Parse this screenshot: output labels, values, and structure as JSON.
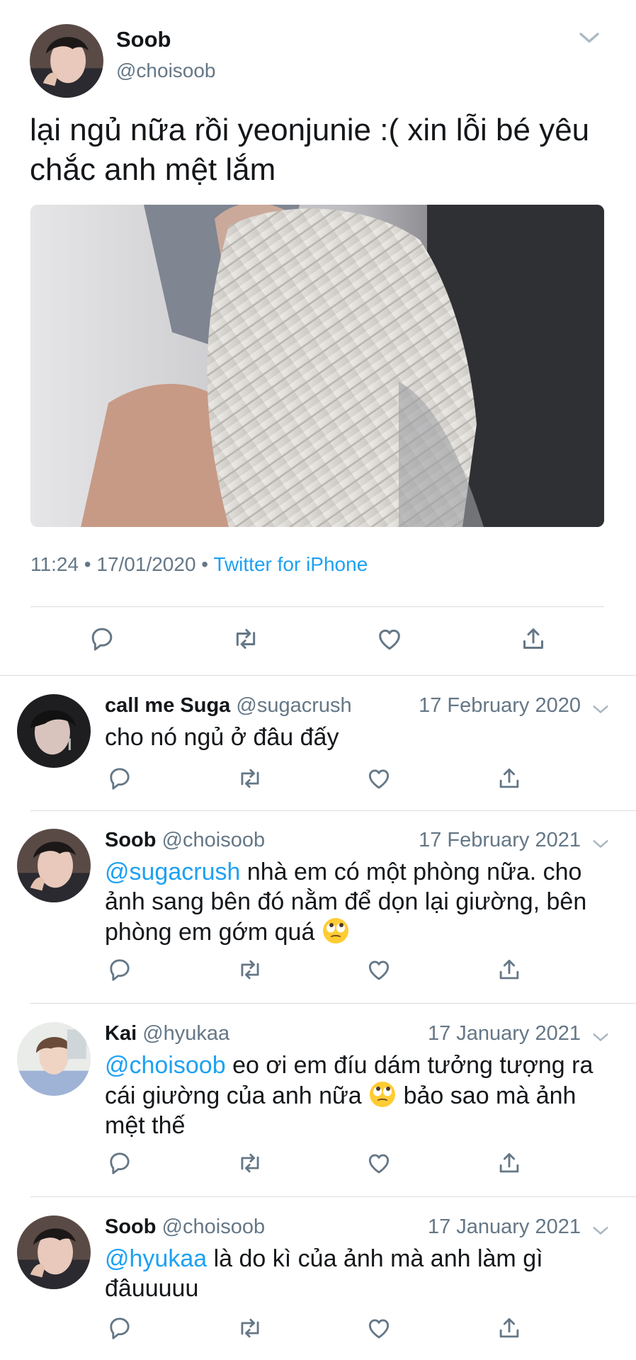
{
  "main_tweet": {
    "author_name": "Soob",
    "author_handle": "@choisoob",
    "text": "lại ngủ nữa rồi yeonjunie :( xin lỗi bé yêu chắc anh mệt lắm",
    "time": "11:24",
    "date": "17/01/2020",
    "source": "Twitter for iPhone",
    "separator": "•"
  },
  "icons": {
    "reply": "speech-bubble-icon",
    "retweet": "retweet-icon",
    "like": "heart-icon",
    "share": "share-icon",
    "more": "chevron-down-icon",
    "emoji": "eye-roll-emoji"
  },
  "colors": {
    "link": "#1da1f2",
    "secondary_text": "#657786",
    "divider": "#d9dee2",
    "text": "#14171a"
  },
  "replies": [
    {
      "name": "call me Suga",
      "handle": "@sugacrush",
      "date": "17 February 2020",
      "mention": "",
      "text": "cho nó ngủ ở đâu đấy",
      "text_after": ""
    },
    {
      "name": "Soob",
      "handle": "@choisoob",
      "date": "17 February 2021",
      "mention": "@sugacrush",
      "text": " nhà em có một phòng nữa. cho ảnh sang bên đó nằm để dọn lại giường, bên phòng em gớm quá ",
      "text_after": ""
    },
    {
      "name": "Kai",
      "handle": "@hyukaa",
      "date": "17 January 2021",
      "mention": "@choisoob",
      "text": " eo ơi em đíu dám tưởng tượng ra cái giường của anh nữa ",
      "text_after": " bảo sao mà ảnh mệt thế"
    },
    {
      "name": "Soob",
      "handle": "@choisoob",
      "date": "17 January 2021",
      "mention": "@hyukaa",
      "text": " là do kì của ảnh mà anh làm gì đâuuuuu",
      "text_after": ""
    }
  ]
}
